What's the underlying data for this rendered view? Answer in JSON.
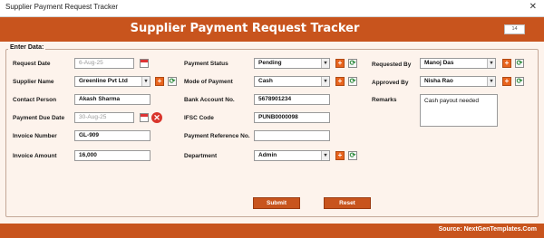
{
  "window": {
    "title": "Supplier Payment Request Tracker",
    "close": "✕"
  },
  "header": {
    "title": "Supplier Payment Request Tracker",
    "record_id": "14"
  },
  "form": {
    "legend": "Enter Data:",
    "request_date": {
      "label": "Request Date",
      "value": "6-Aug-25"
    },
    "supplier_name": {
      "label": "Supplier Name",
      "value": "Greenline Pvt Ltd"
    },
    "contact_person": {
      "label": "Contact Person",
      "value": "Akash Sharma"
    },
    "payment_due_date": {
      "label": "Payment Due Date",
      "value": "30-Aug-25"
    },
    "invoice_number": {
      "label": "Invoice Number",
      "value": "GL-909"
    },
    "invoice_amount": {
      "label": "Invoice Amount",
      "value": "16,000"
    },
    "payment_status": {
      "label": "Payment Status",
      "value": "Pending"
    },
    "mode_of_payment": {
      "label": "Mode of Payment",
      "value": "Cash"
    },
    "bank_account_no": {
      "label": "Bank Account No.",
      "value": "5678901234"
    },
    "ifsc_code": {
      "label": "IFSC Code",
      "value": "PUNB0000098"
    },
    "payment_reference_no": {
      "label": "Payment Reference No.",
      "value": ""
    },
    "department": {
      "label": "Department",
      "value": "Admin"
    },
    "requested_by": {
      "label": "Requested By",
      "value": "Manoj Das"
    },
    "approved_by": {
      "label": "Approved By",
      "value": "Nisha Rao"
    },
    "remarks": {
      "label": "Remarks",
      "value": "Cash payout needed"
    }
  },
  "icons": {
    "plus": "+",
    "refresh": "⟳",
    "dropdown": "▾",
    "clear": "✕"
  },
  "buttons": {
    "submit": "Submit",
    "reset": "Reset"
  },
  "footer": {
    "source": "Source: NextGenTemplates.Com"
  },
  "colors": {
    "accent": "#c8541d",
    "panel": "#fdf3ec"
  }
}
